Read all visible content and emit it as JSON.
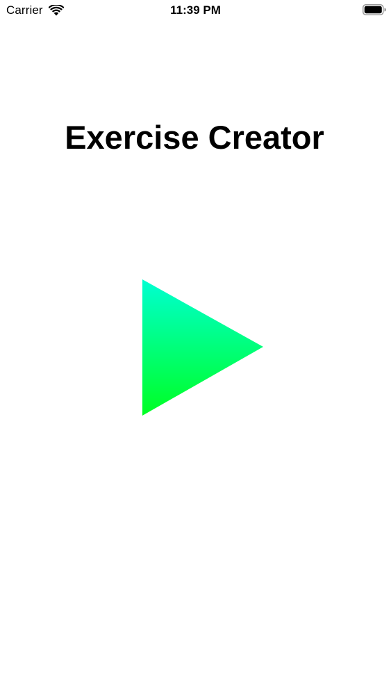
{
  "status_bar": {
    "carrier": "Carrier",
    "time": "11:39 PM",
    "wifi_icon": "wifi-icon",
    "battery_icon": "battery-icon",
    "battery_level": 1.0
  },
  "main": {
    "title": "Exercise Creator",
    "play_button": {
      "icon": "play-icon",
      "gradient_top": "#00FFD2",
      "gradient_bottom": "#00FF22"
    }
  }
}
